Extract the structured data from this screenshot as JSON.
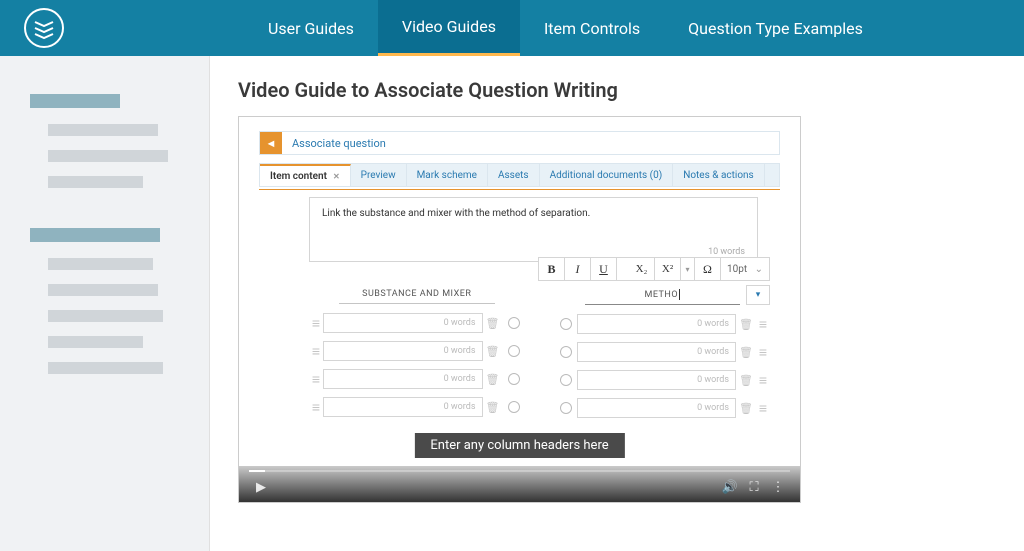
{
  "nav": {
    "items": [
      "User Guides",
      "Video Guides",
      "Item Controls",
      "Question Type Examples"
    ],
    "active": 1
  },
  "page": {
    "title": "Video Guide to Associate Question Writing"
  },
  "video": {
    "breadcrumb": "Associate question",
    "tabs": [
      {
        "label": "Item content",
        "active": true,
        "closable": true
      },
      {
        "label": "Preview"
      },
      {
        "label": "Mark scheme"
      },
      {
        "label": "Assets"
      },
      {
        "label": "Additional documents (0)"
      },
      {
        "label": "Notes & actions"
      }
    ],
    "prompt": "Link the substance and mixer with the method of separation.",
    "prompt_words": "10 words",
    "toolbar": {
      "bold": "B",
      "italic": "I",
      "underline": "U",
      "sub": "X₂",
      "sup": "X²",
      "omega": "Ω",
      "fontsize": "10pt"
    },
    "columns": {
      "left": {
        "header": "SUBSTANCE AND MIXER"
      },
      "right": {
        "header": "METHO"
      }
    },
    "row_placeholder": "0 words",
    "caption": "Enter any column headers here"
  }
}
